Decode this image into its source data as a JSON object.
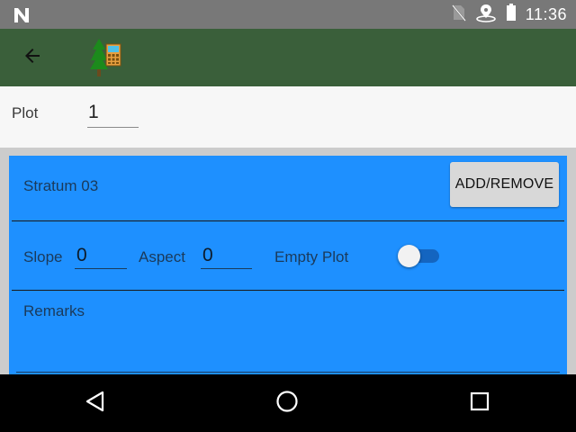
{
  "status_bar": {
    "time": "11:36",
    "icons": [
      "n-notification-icon",
      "no-sim-icon",
      "location-icon",
      "battery-icon"
    ]
  },
  "app_bar": {
    "back_icon": "arrow-left-icon",
    "logo_icon": "tree-plot-logo-icon",
    "color": "#3a5f3a"
  },
  "plot": {
    "label": "Plot",
    "value": "1"
  },
  "stratum": {
    "title": "Stratum 03",
    "add_remove_label": "ADD/REMOVE",
    "card_color": "#1e90ff",
    "slope_label": "Slope",
    "slope_value": "0",
    "aspect_label": "Aspect",
    "aspect_value": "0",
    "empty_plot_label": "Empty Plot",
    "empty_plot_on": false,
    "remarks_label": "Remarks",
    "remarks_value": ""
  },
  "nav_bar": {
    "icons": [
      "back-triangle-icon",
      "home-circle-icon",
      "recents-square-icon"
    ]
  }
}
